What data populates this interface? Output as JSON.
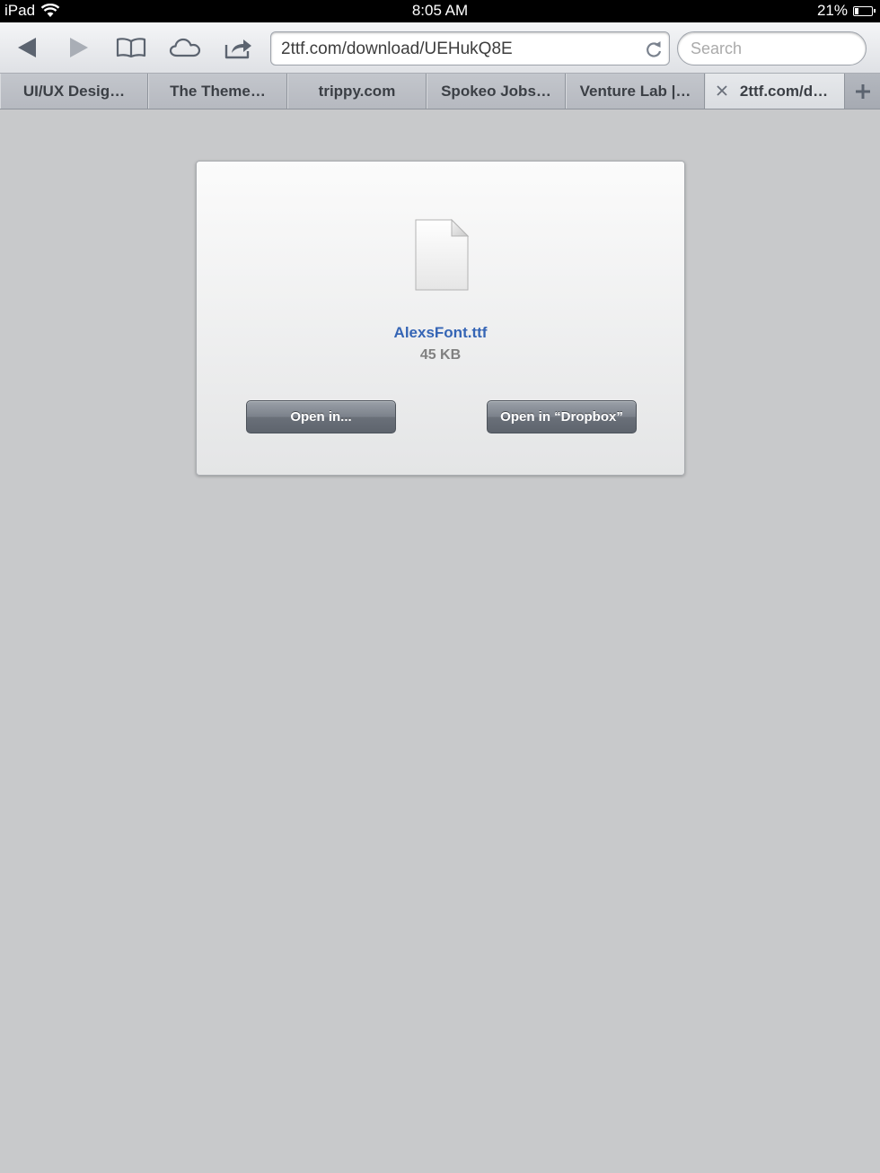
{
  "status_bar": {
    "device": "iPad",
    "time": "8:05 AM",
    "battery": "21%",
    "battery_level": 0.21
  },
  "toolbar": {
    "url": "2ttf.com/download/UEHukQ8E",
    "search_placeholder": "Search"
  },
  "tabs": [
    {
      "label": "UI/UX Desig…",
      "active": false
    },
    {
      "label": "The Theme…",
      "active": false
    },
    {
      "label": "trippy.com",
      "active": false
    },
    {
      "label": "Spokeo Jobs…",
      "active": false
    },
    {
      "label": "Venture Lab |…",
      "active": false
    },
    {
      "label": "2ttf.com/d…",
      "active": true
    }
  ],
  "download": {
    "file_name": "AlexsFont.ttf",
    "file_size": "45 KB",
    "open_in_label": "Open in...",
    "open_in_dropbox_label": "Open in “Dropbox”",
    "link_color": "#3565b5"
  }
}
